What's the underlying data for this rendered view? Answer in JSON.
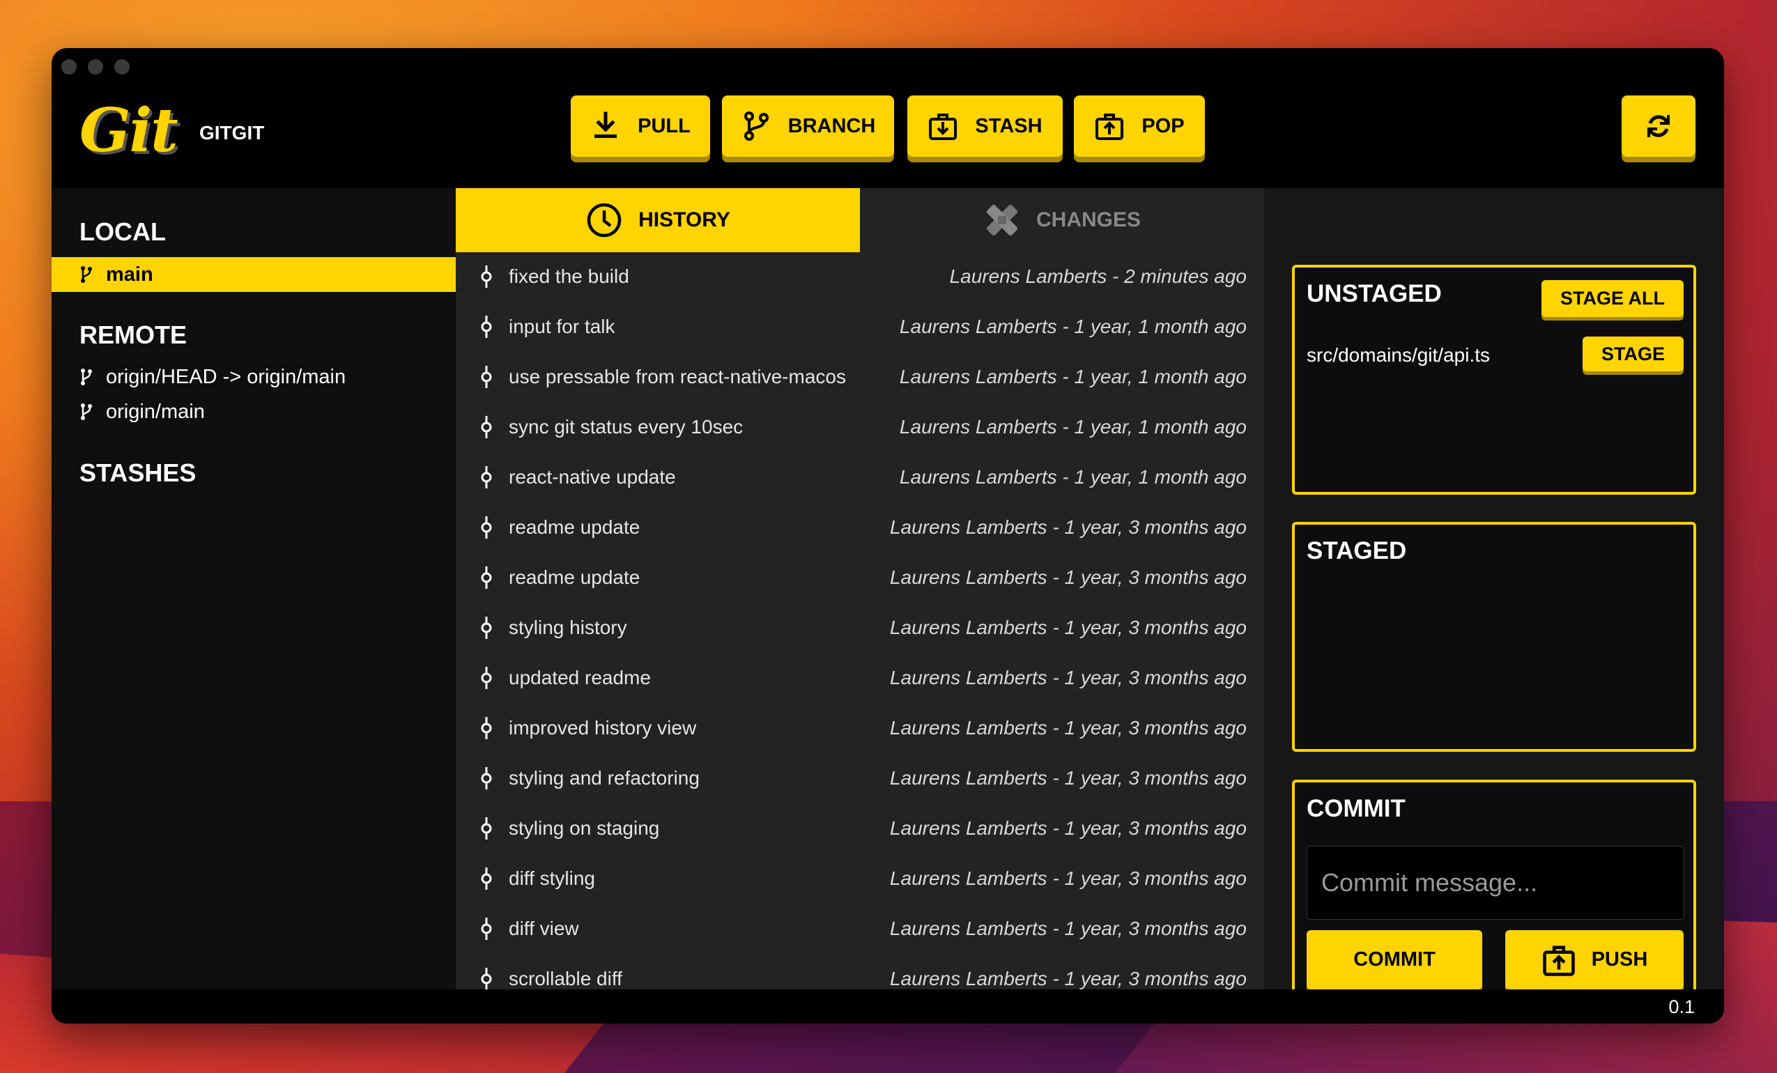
{
  "app": {
    "logo_text": "Git",
    "name": "GITGIT",
    "version": "0.1"
  },
  "toolbar": {
    "pull_label": "PULL",
    "branch_label": "BRANCH",
    "stash_label": "STASH",
    "pop_label": "POP",
    "icons": [
      "download-icon",
      "git-branch-icon",
      "stash-box-icon",
      "pop-box-icon",
      "refresh-icon"
    ]
  },
  "sidebar": {
    "local_title": "LOCAL",
    "local_branches": [
      {
        "label": "main",
        "active": true
      }
    ],
    "remote_title": "REMOTE",
    "remote_branches": [
      {
        "label": "origin/HEAD -> origin/main"
      },
      {
        "label": "origin/main"
      }
    ],
    "stashes_title": "STASHES"
  },
  "tabs": {
    "history_label": "HISTORY",
    "changes_label": "CHANGES",
    "active": "history"
  },
  "history": [
    {
      "message": "fixed the build",
      "meta": "Laurens Lamberts - 2 minutes ago"
    },
    {
      "message": "input for talk",
      "meta": "Laurens Lamberts - 1 year, 1 month ago"
    },
    {
      "message": "use pressable from react-native-macos",
      "meta": "Laurens Lamberts - 1 year, 1 month ago"
    },
    {
      "message": "sync git status every 10sec",
      "meta": "Laurens Lamberts - 1 year, 1 month ago"
    },
    {
      "message": "react-native update",
      "meta": "Laurens Lamberts - 1 year, 1 month ago"
    },
    {
      "message": "readme update",
      "meta": "Laurens Lamberts - 1 year, 3 months ago"
    },
    {
      "message": "readme update",
      "meta": "Laurens Lamberts - 1 year, 3 months ago"
    },
    {
      "message": "styling history",
      "meta": "Laurens Lamberts - 1 year, 3 months ago"
    },
    {
      "message": "updated readme",
      "meta": "Laurens Lamberts - 1 year, 3 months ago"
    },
    {
      "message": "improved history view",
      "meta": "Laurens Lamberts - 1 year, 3 months ago"
    },
    {
      "message": "styling and refactoring",
      "meta": "Laurens Lamberts - 1 year, 3 months ago"
    },
    {
      "message": "styling on staging",
      "meta": "Laurens Lamberts - 1 year, 3 months ago"
    },
    {
      "message": "diff styling",
      "meta": "Laurens Lamberts - 1 year, 3 months ago"
    },
    {
      "message": "diff view",
      "meta": "Laurens Lamberts - 1 year, 3 months ago"
    },
    {
      "message": "scrollable diff",
      "meta": "Laurens Lamberts - 1 year, 3 months ago"
    }
  ],
  "unstaged": {
    "title": "UNSTAGED",
    "stage_all_label": "STAGE ALL",
    "files": [
      {
        "path": "src/domains/git/api.ts",
        "action": "STAGE"
      }
    ]
  },
  "staged": {
    "title": "STAGED",
    "files": []
  },
  "commit": {
    "title": "COMMIT",
    "placeholder": "Commit message...",
    "value": "",
    "commit_label": "COMMIT",
    "push_label": "PUSH"
  },
  "colors": {
    "accent": "#ffd400",
    "window_bg": "#000000",
    "history_bg": "#232323",
    "sidebar_bg": "#0f0f0f"
  }
}
